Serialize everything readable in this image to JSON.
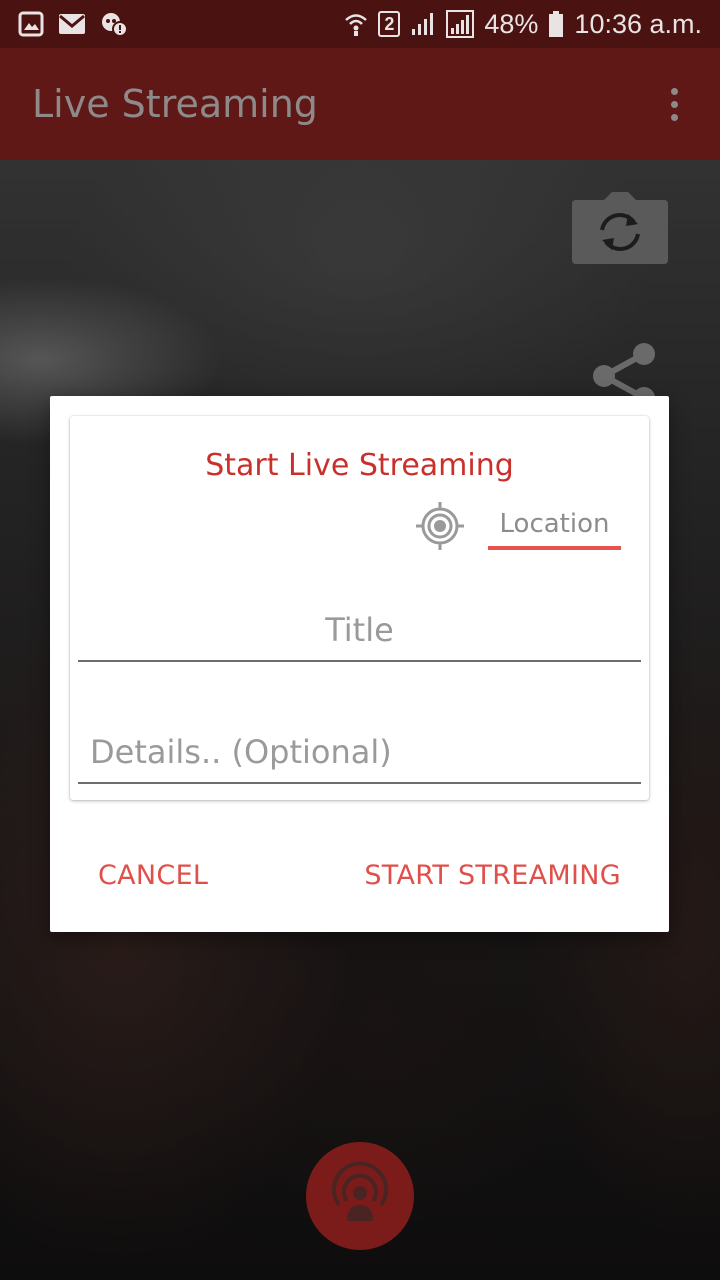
{
  "status_bar": {
    "icons_left": [
      "image-icon",
      "mail-icon",
      "voicemail-icon"
    ],
    "sim_badge": "2",
    "battery": "48%",
    "time": "10:36 a.m.",
    "icons_right": [
      "wifi-icon",
      "signal-icon",
      "signal-icon",
      "battery-icon"
    ]
  },
  "app_bar": {
    "title": "Live Streaming",
    "overflow_icon": "more-vert-icon"
  },
  "camera_controls": {
    "switch_icon": "switch-camera-icon",
    "share_icon": "share-icon",
    "stream_icon": "live-stream-icon"
  },
  "dialog": {
    "title": "Start Live Streaming",
    "location_icon": "gps-target-icon",
    "location_label": "Location",
    "title_placeholder": "Title",
    "details_placeholder": "Details.. (Optional)",
    "cancel_label": "CANCEL",
    "start_label": "START STREAMING"
  },
  "colors": {
    "status_bar": "#4a1210",
    "app_bar": "#5f1816",
    "accent": "#e0504b",
    "dialog_title": "#c9302c",
    "fab": "#7b1c1a"
  }
}
